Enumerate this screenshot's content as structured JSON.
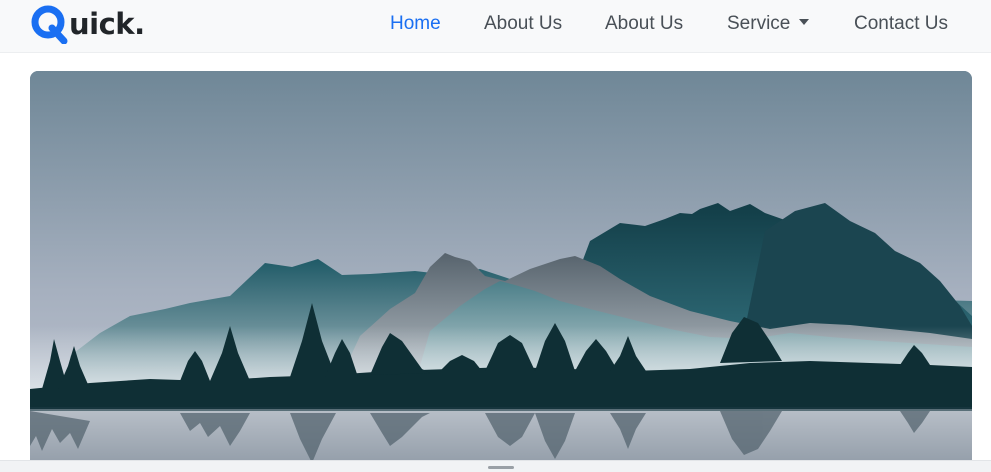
{
  "navbar": {
    "brand": {
      "letter": "Q",
      "rest": "uick."
    },
    "links": [
      {
        "label": "Home",
        "active": true
      },
      {
        "label": "About Us",
        "active": false
      },
      {
        "label": "About Us",
        "active": false
      },
      {
        "label": "Service",
        "active": false,
        "dropdown": true
      },
      {
        "label": "Contact Us",
        "active": false
      }
    ]
  },
  "hero": {
    "image": "mountain-lake-landscape-illustration"
  },
  "colors": {
    "brand_blue": "#1a6ff2",
    "nav_text": "#495057",
    "navbar_bg": "#f8f9fa"
  }
}
